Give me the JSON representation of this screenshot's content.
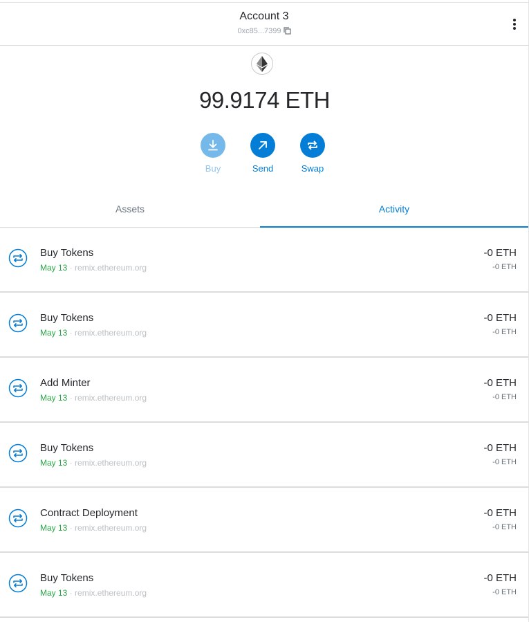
{
  "account": {
    "name": "Account 3",
    "address": "0xc85...7399"
  },
  "balance": {
    "amount": "99.9174 ETH"
  },
  "actions": {
    "buy": "Buy",
    "send": "Send",
    "swap": "Swap"
  },
  "tabs": {
    "assets": "Assets",
    "activity": "Activity",
    "active": "Activity"
  },
  "colors": {
    "accent": "#037dd6",
    "date_green": "#28a745",
    "buy_disabled": "#75b8ea"
  },
  "activity": [
    {
      "title": "Buy Tokens",
      "date": "May 13",
      "origin": "remix.ethereum.org",
      "amount": "-0 ETH",
      "fiat": "-0 ETH"
    },
    {
      "title": "Buy Tokens",
      "date": "May 13",
      "origin": "remix.ethereum.org",
      "amount": "-0 ETH",
      "fiat": "-0 ETH"
    },
    {
      "title": "Add Minter",
      "date": "May 13",
      "origin": "remix.ethereum.org",
      "amount": "-0 ETH",
      "fiat": "-0 ETH"
    },
    {
      "title": "Buy Tokens",
      "date": "May 13",
      "origin": "remix.ethereum.org",
      "amount": "-0 ETH",
      "fiat": "-0 ETH"
    },
    {
      "title": "Contract Deployment",
      "date": "May 13",
      "origin": "remix.ethereum.org",
      "amount": "-0 ETH",
      "fiat": "-0 ETH"
    },
    {
      "title": "Buy Tokens",
      "date": "May 13",
      "origin": "remix.ethereum.org",
      "amount": "-0 ETH",
      "fiat": "-0 ETH"
    }
  ],
  "icons": {
    "menu": "kebab-menu-icon",
    "copy": "copy-icon",
    "eth": "ethereum-logo-icon",
    "tx": "swap-arrows-icon"
  }
}
